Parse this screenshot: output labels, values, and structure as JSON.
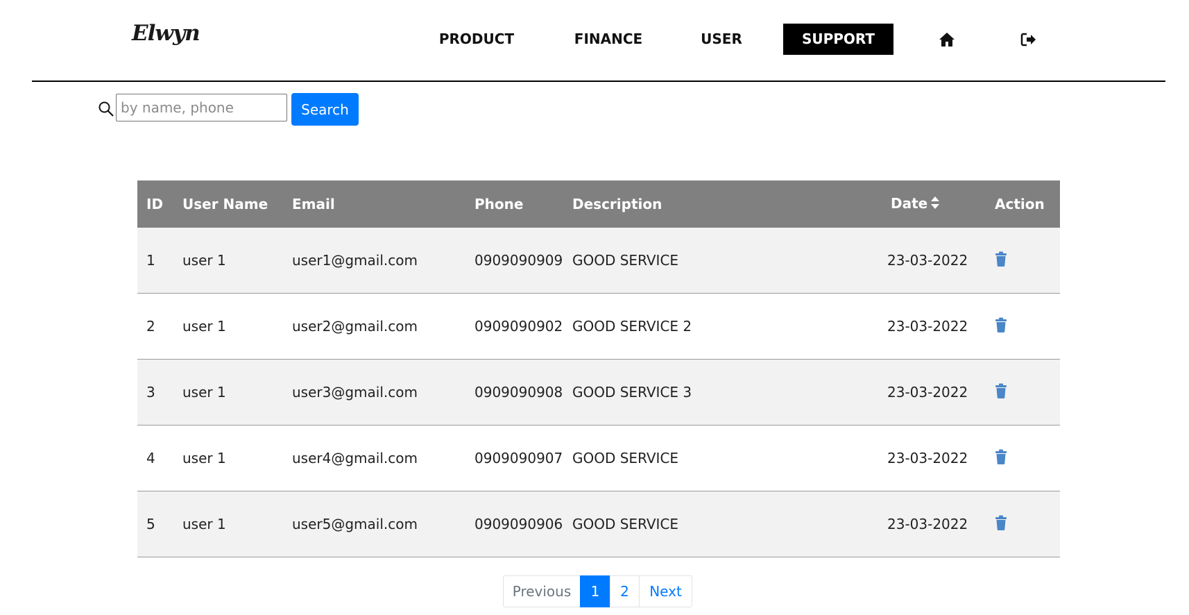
{
  "header": {
    "logo": "Elwyn",
    "nav": {
      "product": "PRODUCT",
      "finance": "FINANCE",
      "user": "USER",
      "support": "SUPPORT"
    },
    "active_nav": "support",
    "icons": [
      "home-icon",
      "logout-icon"
    ]
  },
  "search": {
    "placeholder": "by name, phone",
    "value": "",
    "button_label": "Search",
    "button_color": "#007bff"
  },
  "table": {
    "columns": {
      "id": "ID",
      "user_name": "User Name",
      "email": "Email",
      "phone": "Phone",
      "description": "Description",
      "date": "Date",
      "action": "Action"
    },
    "sortable_column": "date",
    "header_color": "#808080",
    "stripe_color": "#f2f2f2",
    "action_icon": "trash-icon",
    "action_icon_color": "#4a86c8",
    "rows": [
      {
        "id": "1",
        "user_name": "user 1",
        "email": "user1@gmail.com",
        "phone": "0909090909",
        "description": "GOOD SERVICE",
        "date": "23-03-2022"
      },
      {
        "id": "2",
        "user_name": "user 1",
        "email": "user2@gmail.com",
        "phone": "0909090902",
        "description": "GOOD SERVICE 2",
        "date": "23-03-2022"
      },
      {
        "id": "3",
        "user_name": "user 1",
        "email": "user3@gmail.com",
        "phone": "0909090908",
        "description": "GOOD SERVICE 3",
        "date": "23-03-2022"
      },
      {
        "id": "4",
        "user_name": "user 1",
        "email": "user4@gmail.com",
        "phone": "0909090907",
        "description": "GOOD SERVICE",
        "date": "23-03-2022"
      },
      {
        "id": "5",
        "user_name": "user 1",
        "email": "user5@gmail.com",
        "phone": "0909090906",
        "description": "GOOD SERVICE",
        "date": "23-03-2022"
      }
    ]
  },
  "pagination": {
    "previous": "Previous",
    "pages": [
      "1",
      "2"
    ],
    "current": "1",
    "next": "Next"
  }
}
